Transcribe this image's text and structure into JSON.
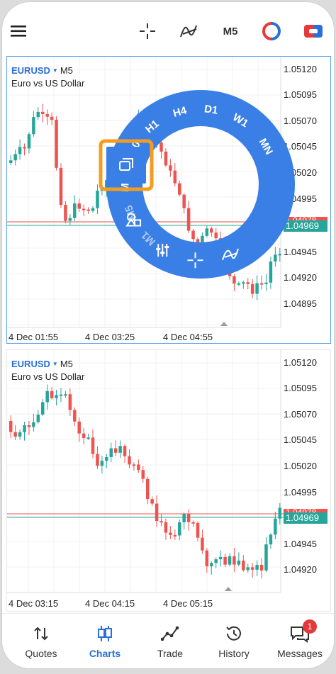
{
  "toolbar": {
    "timeframe": "M5"
  },
  "chart1": {
    "symbol": "EURUSD",
    "timeframe": "M5",
    "description": "Euro vs US Dollar",
    "price_ticks": [
      "1.05120",
      "1.05095",
      "1.05070",
      "1.05045",
      "1.05020",
      "1.04995",
      "1.04945",
      "1.04920",
      "1.04895"
    ],
    "bid_label": "1.04969",
    "ask_label": "1.04978",
    "time_ticks": [
      "4 Dec 01:55",
      "4 Dec 03:25",
      "4 Dec 04:55"
    ]
  },
  "chart2": {
    "symbol": "EURUSD",
    "timeframe": "M5",
    "description": "Euro vs US Dollar",
    "price_ticks": [
      "1.05120",
      "1.05095",
      "1.05070",
      "1.05045",
      "1.05020",
      "1.04995",
      "1.04945",
      "1.04920"
    ],
    "bid_label": "1.04969",
    "ask_label": "1.04978",
    "time_ticks": [
      "4 Dec 03:15",
      "4 Dec 04:15",
      "4 Dec 05:15"
    ]
  },
  "radial_menu": {
    "timeframes": [
      "M5",
      "M15",
      "M30",
      "H1",
      "H4",
      "D1",
      "W1",
      "MN"
    ],
    "partial_label": "M1"
  },
  "nav": {
    "items": [
      {
        "label": "Quotes"
      },
      {
        "label": "Charts"
      },
      {
        "label": "Trade"
      },
      {
        "label": "History"
      },
      {
        "label": "Messages"
      }
    ],
    "messages_badge": "1"
  },
  "colors": {
    "accent": "#2a6fd8",
    "ring": "#3a7fe6",
    "bull": "#26a69a",
    "bear": "#ef5350",
    "highlight": "#f39c1d"
  }
}
